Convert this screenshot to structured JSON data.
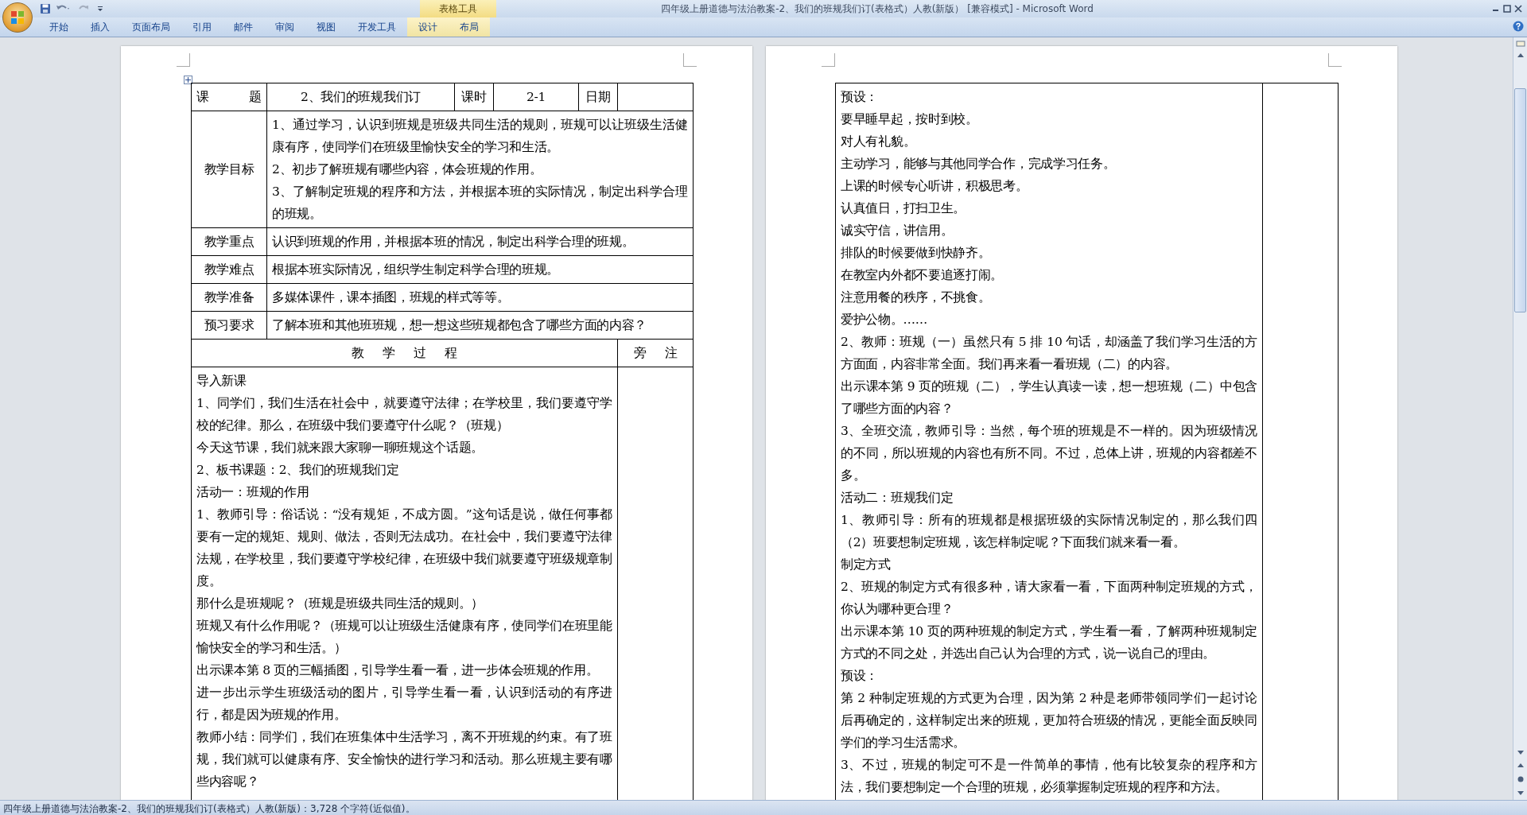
{
  "window": {
    "title": "四年级上册道德与法治教案-2、我们的班规我们订(表格式）人教(新版） [兼容模式] - Microsoft Word"
  },
  "ribbon": {
    "contextual_group": "表格工具",
    "tabs": [
      {
        "label": "开始",
        "contextual": false
      },
      {
        "label": "插入",
        "contextual": false
      },
      {
        "label": "页面布局",
        "contextual": false
      },
      {
        "label": "引用",
        "contextual": false
      },
      {
        "label": "邮件",
        "contextual": false
      },
      {
        "label": "审阅",
        "contextual": false
      },
      {
        "label": "视图",
        "contextual": false
      },
      {
        "label": "开发工具",
        "contextual": false
      },
      {
        "label": "设计",
        "contextual": true
      },
      {
        "label": "布局",
        "contextual": true
      }
    ]
  },
  "page_1": {
    "header_row": [
      "课　　题",
      "2、我们的班规我们订",
      "课时",
      "2-1",
      "日期"
    ],
    "rows": [
      {
        "label": "教学目标",
        "paragraphs": [
          "1、通过学习，认识到班规是班级共同生活的规则，班规可以让班级生活健康有序，使同学们在班级里愉快安全的学习和生活。",
          "2、初步了解班规有哪些内容，体会班规的作用。",
          "3、了解制定班规的程序和方法，并根据本班的实际情况，制定出科学合理的班规。"
        ]
      },
      {
        "label": "教学重点",
        "paragraphs": [
          "认识到班规的作用，并根据本班的情况，制定出科学合理的班规。"
        ]
      },
      {
        "label": "教学难点",
        "paragraphs": [
          "根据本班实际情况，组织学生制定科学合理的班规。"
        ]
      },
      {
        "label": "教学准备",
        "paragraphs": [
          "多媒体课件，课本插图，班规的样式等等。"
        ]
      },
      {
        "label": "预习要求",
        "paragraphs": [
          "了解本班和其他班班规，想一想这些班规都包含了哪些方面的内容？"
        ]
      }
    ],
    "process_header": {
      "title": "教 学 过 程",
      "notes": "旁 注"
    },
    "process": [
      "导入新课",
      "1、同学们，我们生活在社会中，就要遵守法律；在学校里，我们要遵守学校的纪律。那么，在班级中我们要遵守什么呢？（班规）",
      "今天这节课，我们就来跟大家聊一聊班规这个话题。",
      "2、板书课题：2、我们的班规我们定",
      "活动一：班规的作用",
      "1、教师引导：俗话说：“没有规矩，不成方圆。”这句话是说，做任何事都要有一定的规矩、规则、做法，否则无法成功。在社会中，我们要遵守法律法规，在学校里，我们要遵守学校纪律，在班级中我们就要遵守班级规章制度。",
      "那什么是班规呢？（班规是班级共同生活的规则。）",
      "班规又有什么作用呢？（班规可以让班级生活健康有序，使同学们在班里能愉快安全的学习和生活。）",
      "出示课本第 8 页的三幅插图，引导学生看一看，进一步体会班规的作用。",
      "进一步出示学生班级活动的图片，引导学生看一看，认识到活动的有序进行，都是因为班规的作用。",
      "教师小结：同学们，我们在班集体中生活学习，离不开班规的约束。有了班规，我们就可以健康有序、安全愉快的进行学习和活动。那么班规主要有哪些内容呢？"
    ]
  },
  "page_2": {
    "process": [
      "预设：",
      "要早睡早起，按时到校。",
      "对人有礼貌。",
      "主动学习，能够与其他同学合作，完成学习任务。",
      "上课的时候专心听讲，积极思考。",
      "认真值日，打扫卫生。",
      "诚实守信，讲信用。",
      "排队的时候要做到快静齐。",
      "在教室内外都不要追逐打闹。",
      "注意用餐的秩序，不挑食。",
      "爱护公物。……",
      "2、教师：班规（一）虽然只有 5 排 10 句话，却涵盖了我们学习生活的方方面面，内容非常全面。我们再来看一看班规（二）的内容。",
      "出示课本第 9 页的班规（二），学生认真读一读，想一想班规（二）中包含了哪些方面的内容？",
      "3、全班交流，教师引导：当然，每个班的班规是不一样的。因为班级情况的不同，所以班规的内容也有所不同。不过，总体上讲，班规的内容都差不多。",
      "活动二：班规我们定",
      "1、教师引导：所有的班规都是根据班级的实际情况制定的，那么我们四（2）班要想制定班规，该怎样制定呢？下面我们就来看一看。",
      "制定方式",
      "2、班规的制定方式有很多种，请大家看一看，下面两种制定班规的方式，你认为哪种更合理？",
      "出示课本第 10 页的两种班规的制定方式，学生看一看，了解两种班规制定方式的不同之处，并选出自己认为合理的方式，说一说自己的理由。",
      "预设：",
      "第 2 种制定班规的方式更为合理，因为第 2 种是老师带领同学们一起讨论后再确定的，这样制定出来的班规，更加符合班级的情况，更能全面反映同学们的学习生活需求。",
      "3、不过，班规的制定可不是一件简单的事情，他有比较复杂的程序和方法，我们要想制定一个合理的班规，必须掌握制定班规的程序和方法。"
    ]
  },
  "status_bar": {
    "text": "四年级上册道德与法治教案-2、我们的班规我们订(表格式）人教(新版)：3,728 个字符(近似值)。"
  }
}
